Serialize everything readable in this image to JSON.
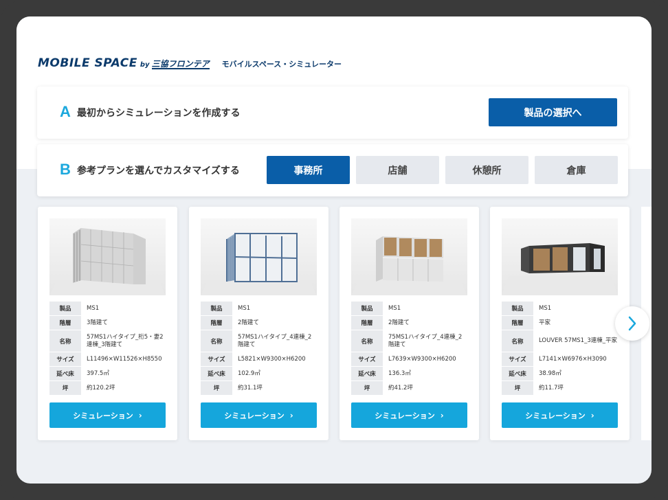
{
  "header": {
    "logo_main": "MOBILE SPACE",
    "logo_by": "by",
    "logo_brand": "三協フロンテア",
    "subtitle": "モバイルスペース・シミュレーター"
  },
  "section_a": {
    "letter": "A",
    "text": "最初からシミュレーションを作成する",
    "button": "製品の選択へ"
  },
  "section_b": {
    "letter": "B",
    "text": "参考プランを選んでカスタマイズする",
    "tabs": [
      "事務所",
      "店舗",
      "休憩所",
      "倉庫"
    ],
    "active_tab": "事務所"
  },
  "spec_labels": [
    "製品",
    "階層",
    "名称",
    "サイズ",
    "延べ床",
    "坪"
  ],
  "cards": [
    {
      "product": "MS1",
      "floors": "3階建て",
      "name": "57MS1ハイタイプ_桁5・妻2連棟_3階建て",
      "size": "L11496×W11526×H8550",
      "floor_area": "397.5㎡",
      "tsubo": "約120.2坪",
      "button": "シミュレーション"
    },
    {
      "product": "MS1",
      "floors": "2階建て",
      "name": "57MS1ハイタイプ_4連棟_2階建て",
      "size": "L5821×W9300×H6200",
      "floor_area": "102.9㎡",
      "tsubo": "約31.1坪",
      "button": "シミュレーション"
    },
    {
      "product": "MS1",
      "floors": "2階建て",
      "name": "75MS1ハイタイプ_4連棟_2階建て",
      "size": "L7639×W9300×H6200",
      "floor_area": "136.3㎡",
      "tsubo": "約41.2坪",
      "button": "シミュレーション"
    },
    {
      "product": "MS1",
      "floors": "平家",
      "name": "LOUVER 57MS1_3連棟_平家",
      "size": "L7141×W6976×H3090",
      "floor_area": "38.98㎡",
      "tsubo": "約11.7坪",
      "button": "シミュレーション"
    }
  ],
  "colors": {
    "primary": "#0a5ea8",
    "accent": "#15a6dc",
    "background": "#edf0f4"
  }
}
